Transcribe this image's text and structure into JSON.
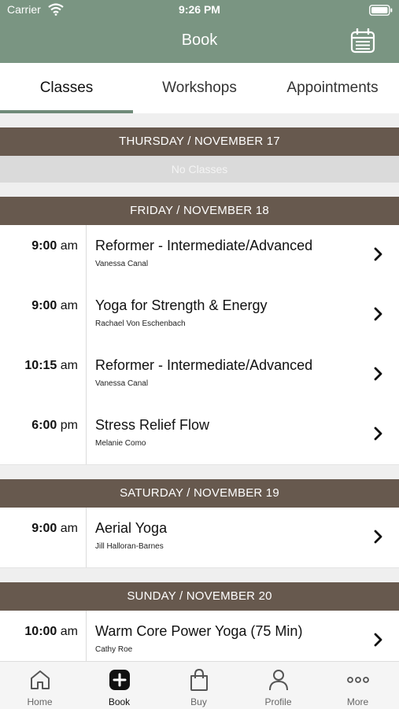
{
  "status": {
    "carrier": "Carrier",
    "time": "9:26 PM"
  },
  "nav": {
    "title": "Book"
  },
  "tabs": [
    {
      "label": "Classes"
    },
    {
      "label": "Workshops"
    },
    {
      "label": "Appointments"
    }
  ],
  "days": [
    {
      "header": "THURSDAY / NOVEMBER 17",
      "empty_text": "No Classes"
    },
    {
      "header": "FRIDAY / NOVEMBER 18",
      "classes": [
        {
          "time": "9:00",
          "ampm": "am",
          "name": "Reformer - Intermediate/Advanced",
          "instructor": "Vanessa Canal"
        },
        {
          "time": "9:00",
          "ampm": "am",
          "name": "Yoga for Strength & Energy",
          "instructor": "Rachael Von Eschenbach"
        },
        {
          "time": "10:15",
          "ampm": "am",
          "name": "Reformer - Intermediate/Advanced",
          "instructor": "Vanessa Canal"
        },
        {
          "time": "6:00",
          "ampm": "pm",
          "name": "Stress Relief Flow",
          "instructor": "Melanie Como"
        }
      ]
    },
    {
      "header": "SATURDAY / NOVEMBER 19",
      "classes": [
        {
          "time": "9:00",
          "ampm": "am",
          "name": "Aerial Yoga",
          "instructor": "Jill Halloran-Barnes"
        }
      ]
    },
    {
      "header": "SUNDAY / NOVEMBER 20",
      "classes": [
        {
          "time": "10:00",
          "ampm": "am",
          "name": "Warm Core Power Yoga (75 Min)",
          "instructor": "Cathy Roe"
        }
      ]
    }
  ],
  "bottom_nav": [
    {
      "label": "Home",
      "icon": "home-icon"
    },
    {
      "label": "Book",
      "icon": "plus-square-icon",
      "active": true
    },
    {
      "label": "Buy",
      "icon": "shopping-bag-icon"
    },
    {
      "label": "Profile",
      "icon": "person-icon"
    },
    {
      "label": "More",
      "icon": "ellipsis-icon"
    }
  ],
  "colors": {
    "header_green": "#7a9582",
    "day_header_brown": "#67594e",
    "tab_underline": "#6f8b79"
  }
}
